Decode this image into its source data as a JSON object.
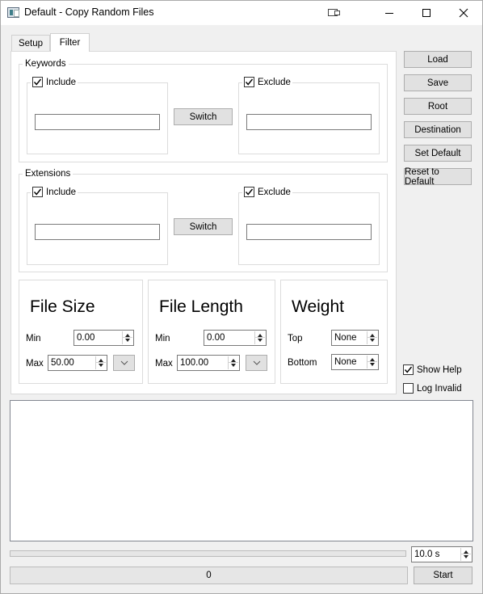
{
  "window": {
    "title": "Default - Copy Random Files"
  },
  "tabs": [
    {
      "label": "Setup",
      "active": false
    },
    {
      "label": "Filter",
      "active": true
    }
  ],
  "keywords": {
    "group_title": "Keywords",
    "include": {
      "label": "Include",
      "checked": true,
      "value": ""
    },
    "switch_label": "Switch",
    "exclude": {
      "label": "Exclude",
      "checked": true,
      "value": ""
    }
  },
  "extensions": {
    "group_title": "Extensions",
    "include": {
      "label": "Include",
      "checked": true,
      "value": ""
    },
    "switch_label": "Switch",
    "exclude": {
      "label": "Exclude",
      "checked": true,
      "value": ""
    }
  },
  "file_size": {
    "title": "File Size",
    "min_label": "Min",
    "min_value": "0.00",
    "max_label": "Max",
    "max_value": "50.00"
  },
  "file_length": {
    "title": "File Length",
    "min_label": "Min",
    "min_value": "0.00",
    "max_label": "Max",
    "max_value": "100.00"
  },
  "weight": {
    "title": "Weight",
    "top_label": "Top",
    "top_value": "None",
    "bottom_label": "Bottom",
    "bottom_value": "None"
  },
  "side_buttons": {
    "load": "Load",
    "save": "Save",
    "root": "Root",
    "destination": "Destination",
    "set_default": "Set Default",
    "reset_default": "Reset to Default"
  },
  "options": {
    "show_help": {
      "label": "Show Help",
      "checked": true
    },
    "log_invalid": {
      "label": "Log Invalid",
      "checked": false
    }
  },
  "log": {
    "text": ""
  },
  "footer": {
    "interval_value": "10.0 s",
    "progress": 0,
    "status_text": "0",
    "start_label": "Start"
  }
}
